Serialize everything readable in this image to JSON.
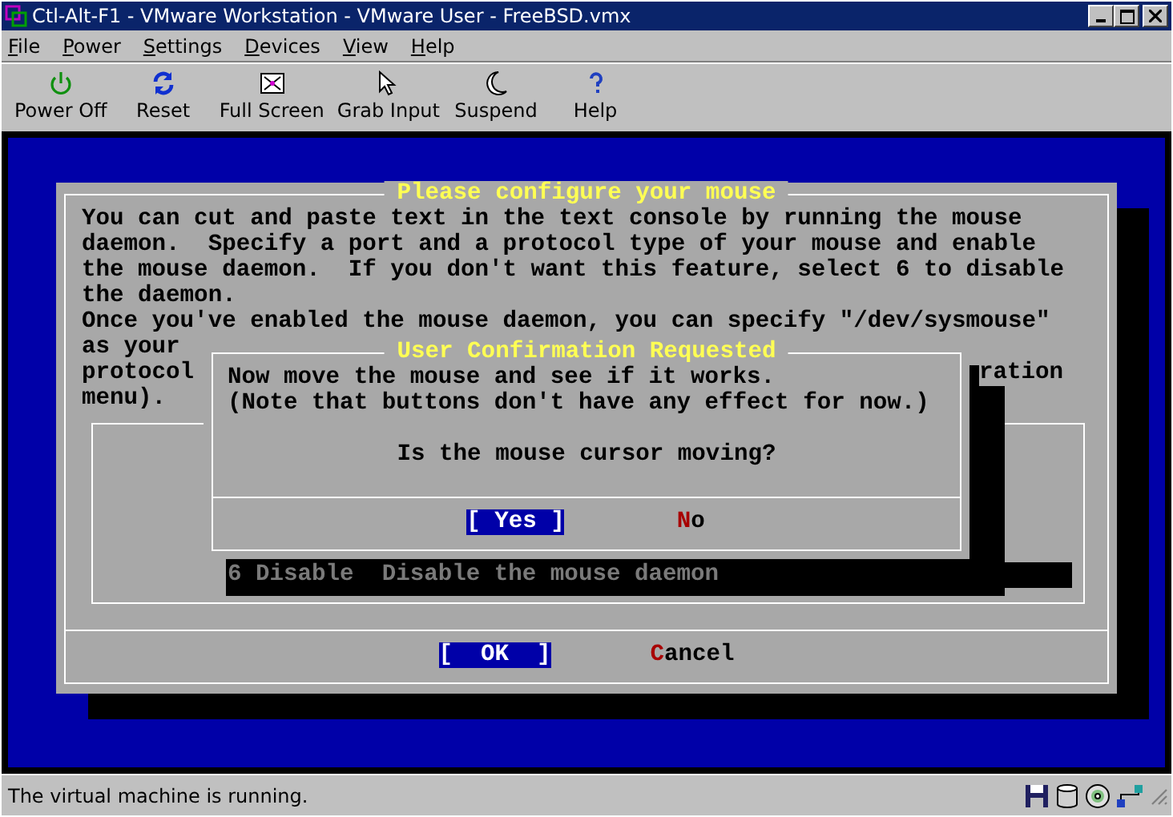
{
  "window": {
    "title": "Ctl-Alt-F1 - VMware Workstation - VMware User - FreeBSD.vmx"
  },
  "menu": [
    "File",
    "Power",
    "Settings",
    "Devices",
    "View",
    "Help"
  ],
  "toolbar": [
    {
      "kind": "power",
      "label": "Power Off"
    },
    {
      "kind": "reset",
      "label": "Reset"
    },
    {
      "kind": "fullscreen",
      "label": "Full Screen"
    },
    {
      "kind": "grab",
      "label": "Grab Input"
    },
    {
      "kind": "suspend",
      "label": "Suspend"
    },
    {
      "kind": "help",
      "label": "Help"
    }
  ],
  "console": {
    "main_dialog": {
      "title": "Please configure your mouse",
      "lines": [
        "You can cut and paste text in the text console by running the mouse",
        "daemon.  Specify a port and a protocol type of your mouse and enable",
        "the mouse daemon.  If you don't want this feature, select 6 to disable",
        "the daemon.",
        "Once you've enabled the mouse daemon, you can specify \"/dev/sysmouse\"",
        "as your",
        "protocol",
        "menu)."
      ],
      "line_tail": "ration",
      "menu_item": "6 Disable  Disable the mouse daemon",
      "buttons": [
        {
          "label": "[  OK  ]",
          "selected": true
        },
        {
          "label": "Cancel",
          "selected": false
        }
      ]
    },
    "confirm_dialog": {
      "title": "User Confirmation Requested",
      "lines": [
        "Now move the mouse and see if it works.",
        "(Note that buttons don't have any effect for now.)"
      ],
      "question": "Is the mouse cursor moving?",
      "buttons": [
        {
          "label": "[ Yes ]",
          "selected": true
        },
        {
          "label": "No",
          "selected": false
        }
      ]
    }
  },
  "status_bar": {
    "text": "The virtual machine is running."
  }
}
